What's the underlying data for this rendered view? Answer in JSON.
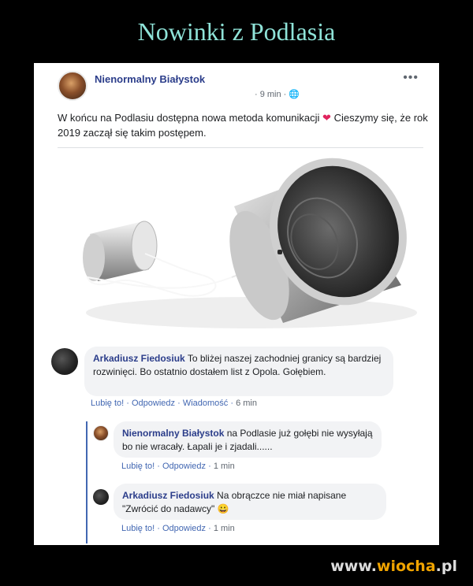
{
  "site": {
    "title": "Nowinki z Podlasia",
    "watermark_a": "www.",
    "watermark_b": "wiocha",
    "watermark_c": ".pl"
  },
  "post": {
    "author": "Nienormalny Białystok",
    "meta": "· 9 min ·",
    "more": "•••",
    "text_a": "W końcu na Podlasiu dostępna nowa metoda komunikacji",
    "text_b": "Cieszymy się, że rok 2019 zaczął się takim postępem.",
    "heart": "❤"
  },
  "comments": [
    {
      "author": "Arkadiusz Fiedosiuk",
      "text": "To bliżej naszej zachodniej granicy są bardziej rozwinięci. Bo ostatnio dostałem list z Opola. Gołębiem.",
      "like": "Lubię to!",
      "reply": "Odpowiedz",
      "message": "Wiadomość",
      "time": "6 min"
    },
    {
      "author": "Nienormalny Białystok",
      "text": "na Podlasie już gołębi nie wysyłają bo nie wracały. Łapali je i zjadali......",
      "like": "Lubię to!",
      "reply": "Odpowiedz",
      "time": "1 min"
    },
    {
      "author": "Arkadiusz Fiedosiuk",
      "text": "Na obrączce nie miał napisane \"Zwrócić do nadawcy\"",
      "emoji": "😀",
      "like": "Lubię to!",
      "reply": "Odpowiedz",
      "time": "1 min"
    }
  ]
}
